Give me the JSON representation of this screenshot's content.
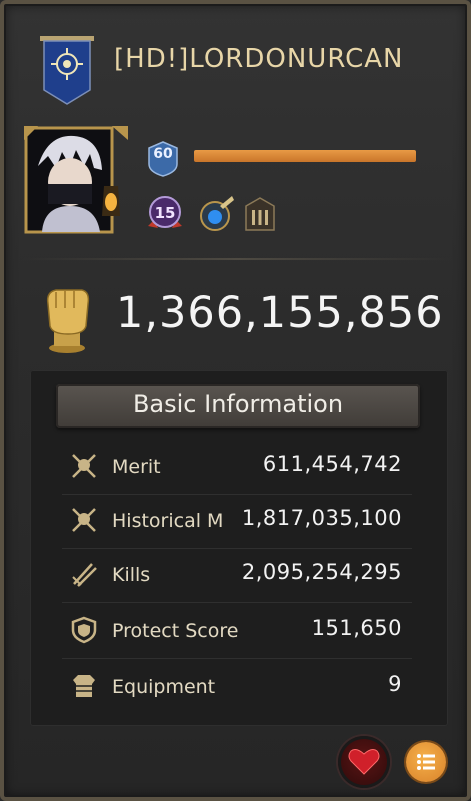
{
  "player": {
    "name": "[HD!]LORDONURCAN",
    "level": "60",
    "vip_level": "15",
    "xp_fraction": 1.0
  },
  "power": {
    "value": "1,366,155,856",
    "icon": "fist-icon"
  },
  "basic_info": {
    "header": "Basic Information",
    "rows": [
      {
        "icon": "crossed-swords-skull-icon",
        "label": "Merit",
        "value": "611,454,742"
      },
      {
        "icon": "crossed-swords-skull-icon",
        "label": "Historical M",
        "value": "1,817,035,100"
      },
      {
        "icon": "crossed-swords-icon",
        "label": "Kills",
        "value": "2,095,254,295"
      },
      {
        "icon": "shield-icon",
        "label": "Protect Score",
        "value": "151,650"
      },
      {
        "icon": "armor-icon",
        "label": "Equipment",
        "value": "9"
      }
    ]
  },
  "colors": {
    "name": "#e8d6a8",
    "xp_bar": "#e0903f",
    "panel": "#1e1e1e",
    "menu_button": "#e8962f"
  }
}
